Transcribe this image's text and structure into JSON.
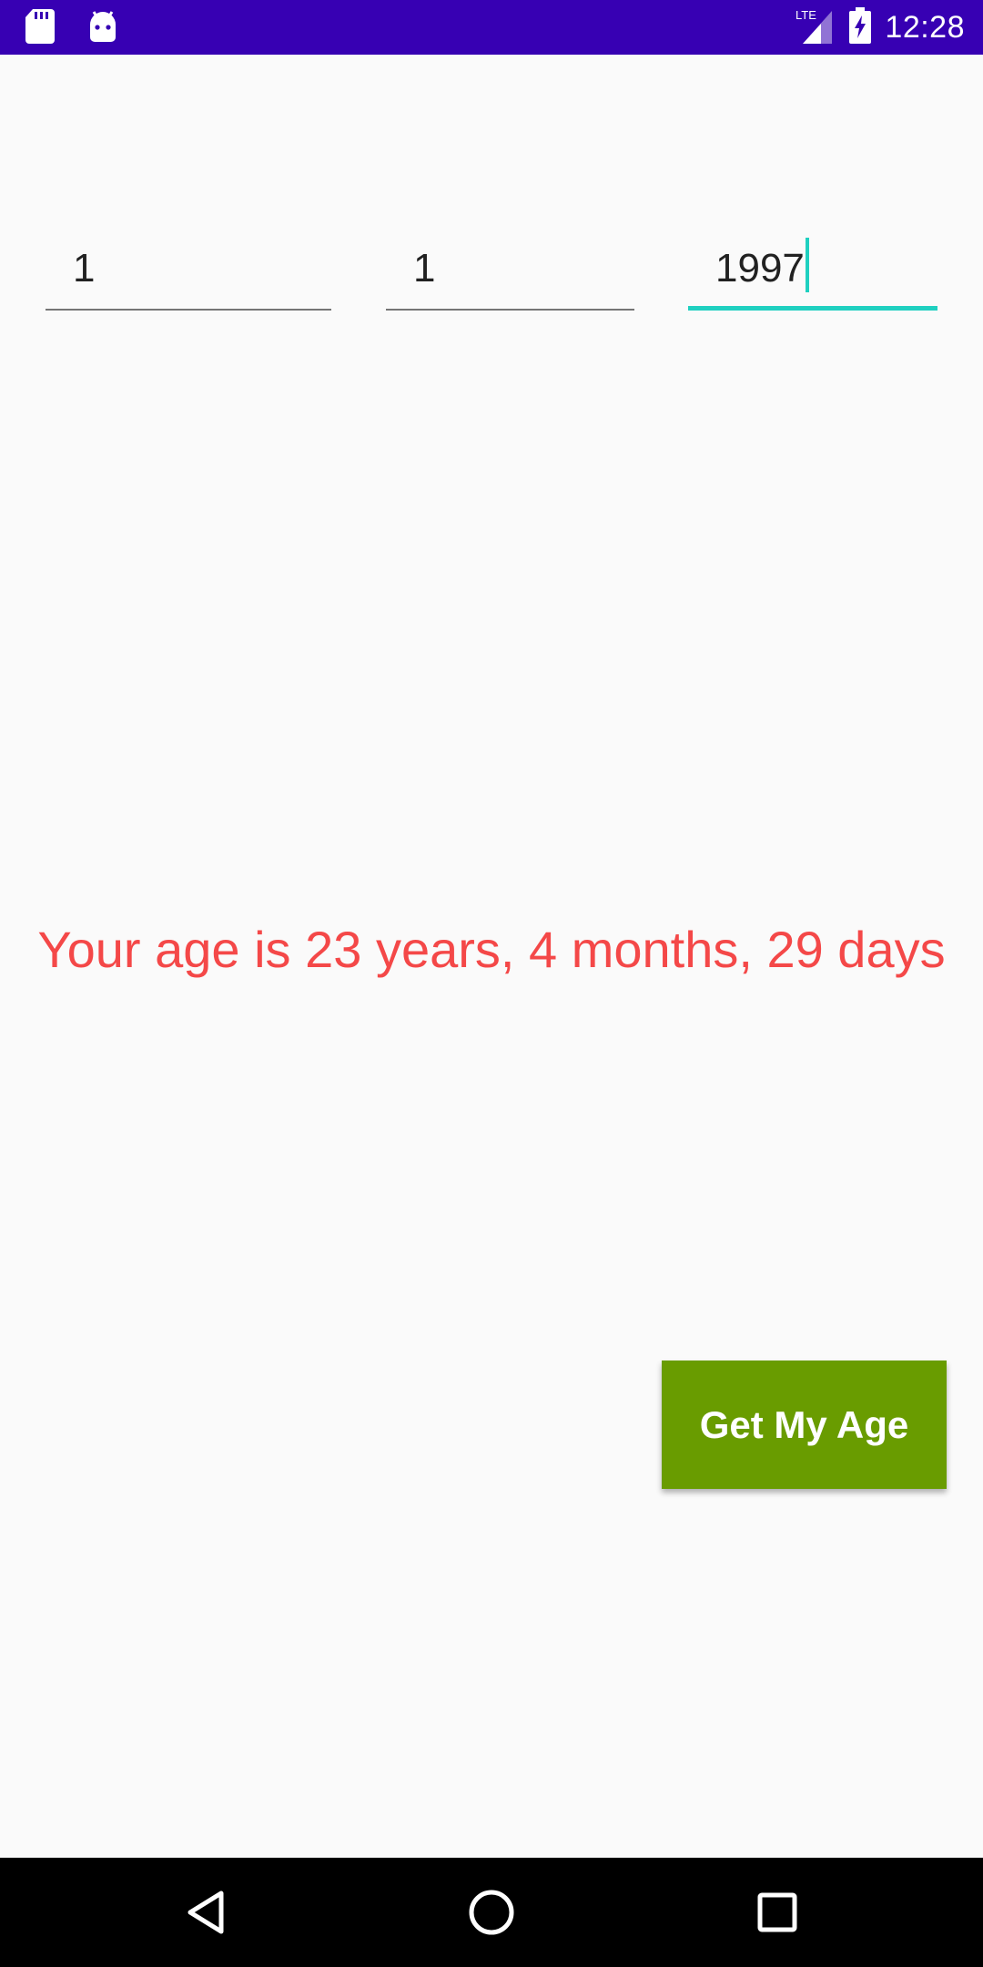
{
  "status_bar": {
    "time": "12:28",
    "network": "LTE",
    "icons": [
      "sd-card-icon",
      "android-icon",
      "signal-icon",
      "battery-charging-icon"
    ],
    "background_color": "#3700b3"
  },
  "form": {
    "day_value": "1",
    "month_value": "1",
    "year_value": "1997",
    "focused_field": "year",
    "accent_color": "#1fd0c0"
  },
  "result": {
    "text": "Your age is 23 years, 4 months, 29 days",
    "color": "#f44848"
  },
  "action": {
    "label": "Get My Age",
    "color": "#699c00"
  },
  "navigation": {
    "icons": [
      "back-icon",
      "home-icon",
      "recents-icon"
    ]
  }
}
